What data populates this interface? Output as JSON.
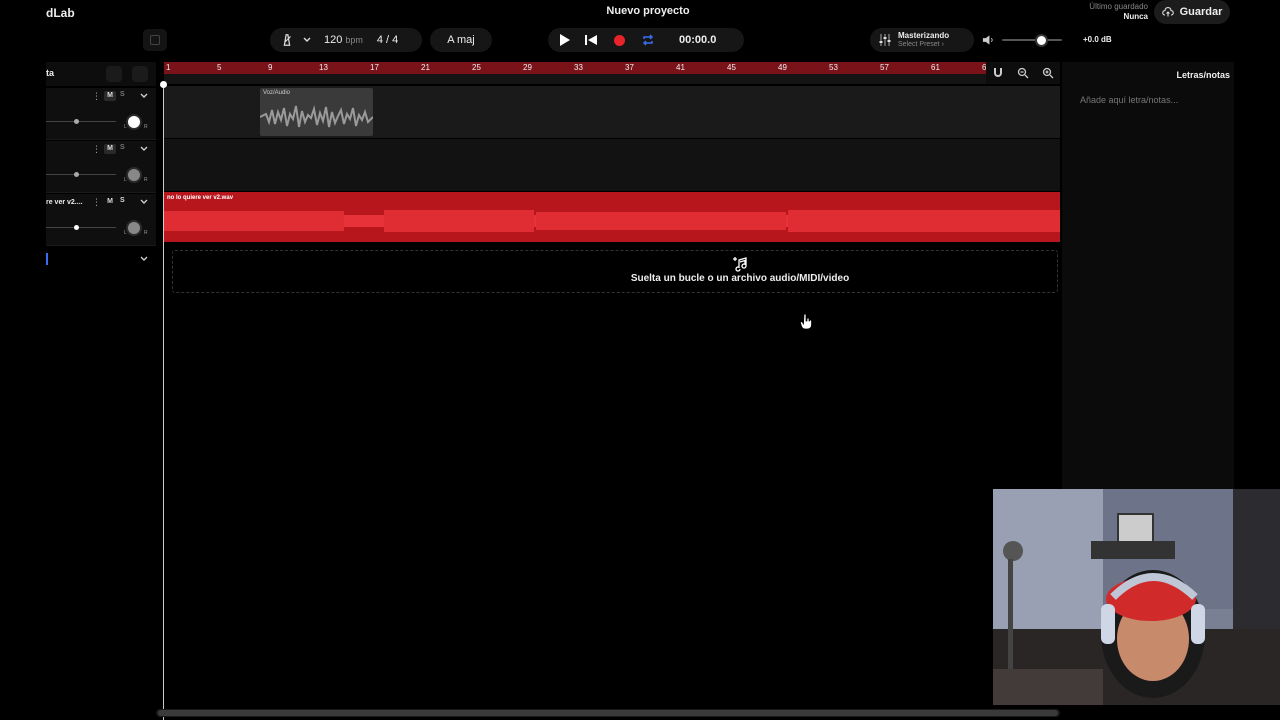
{
  "app": {
    "logo": "dLab",
    "project_title": "Nuevo proyecto"
  },
  "save": {
    "last_saved_label": "Último guardado",
    "last_saved_value": "Nunca",
    "button_label": "Guardar"
  },
  "toolbar": {
    "tempo": "120",
    "tempo_unit": "bpm",
    "time_signature": "4 / 4",
    "key": "A maj",
    "time": "00:00.0",
    "mastering_label": "Masterizando",
    "preset_label": "Select Preset ›",
    "master_volume_db": "+0.0 dB",
    "master_volume_level": 0.68
  },
  "track_panel": {
    "header_label": "ta"
  },
  "tracks": [
    {
      "name": "",
      "mute": "M",
      "solo": "S",
      "fader_level": 0.4,
      "knob": "white"
    },
    {
      "name": "",
      "mute": "M",
      "solo": "S",
      "fader_level": 0.4,
      "knob": "gray"
    },
    {
      "name": "re ver v2....",
      "mute": "M",
      "solo": "S",
      "fader_level": 0.4,
      "knob": "gray"
    }
  ],
  "ruler": {
    "marks": [
      "1",
      "5",
      "9",
      "13",
      "17",
      "21",
      "25",
      "29",
      "33",
      "37",
      "41",
      "45",
      "49",
      "53",
      "57",
      "61",
      "6"
    ]
  },
  "clips": {
    "clip1_name": "Voz/Audio",
    "clip3_name": "no lo quiere ver v2.wav"
  },
  "drop_zone": {
    "text": "Suelta un bucle o un archivo audio/MIDI/video"
  },
  "notes": {
    "title": "Letras/notas",
    "placeholder": "Añade aquí letra/notas..."
  },
  "colors": {
    "accent_red": "#b8161d",
    "ruler_red": "#7a1319",
    "record_red": "#e8232a"
  },
  "icons": [
    "metronome-icon",
    "chevron-down-icon",
    "play-icon",
    "skip-back-icon",
    "record-icon",
    "loop-icon",
    "mixer-icon",
    "volume-icon",
    "cloud-upload-icon",
    "magnet-icon",
    "zoom-out-icon",
    "zoom-in-icon",
    "music-add-icon",
    "hand-cursor-icon"
  ]
}
